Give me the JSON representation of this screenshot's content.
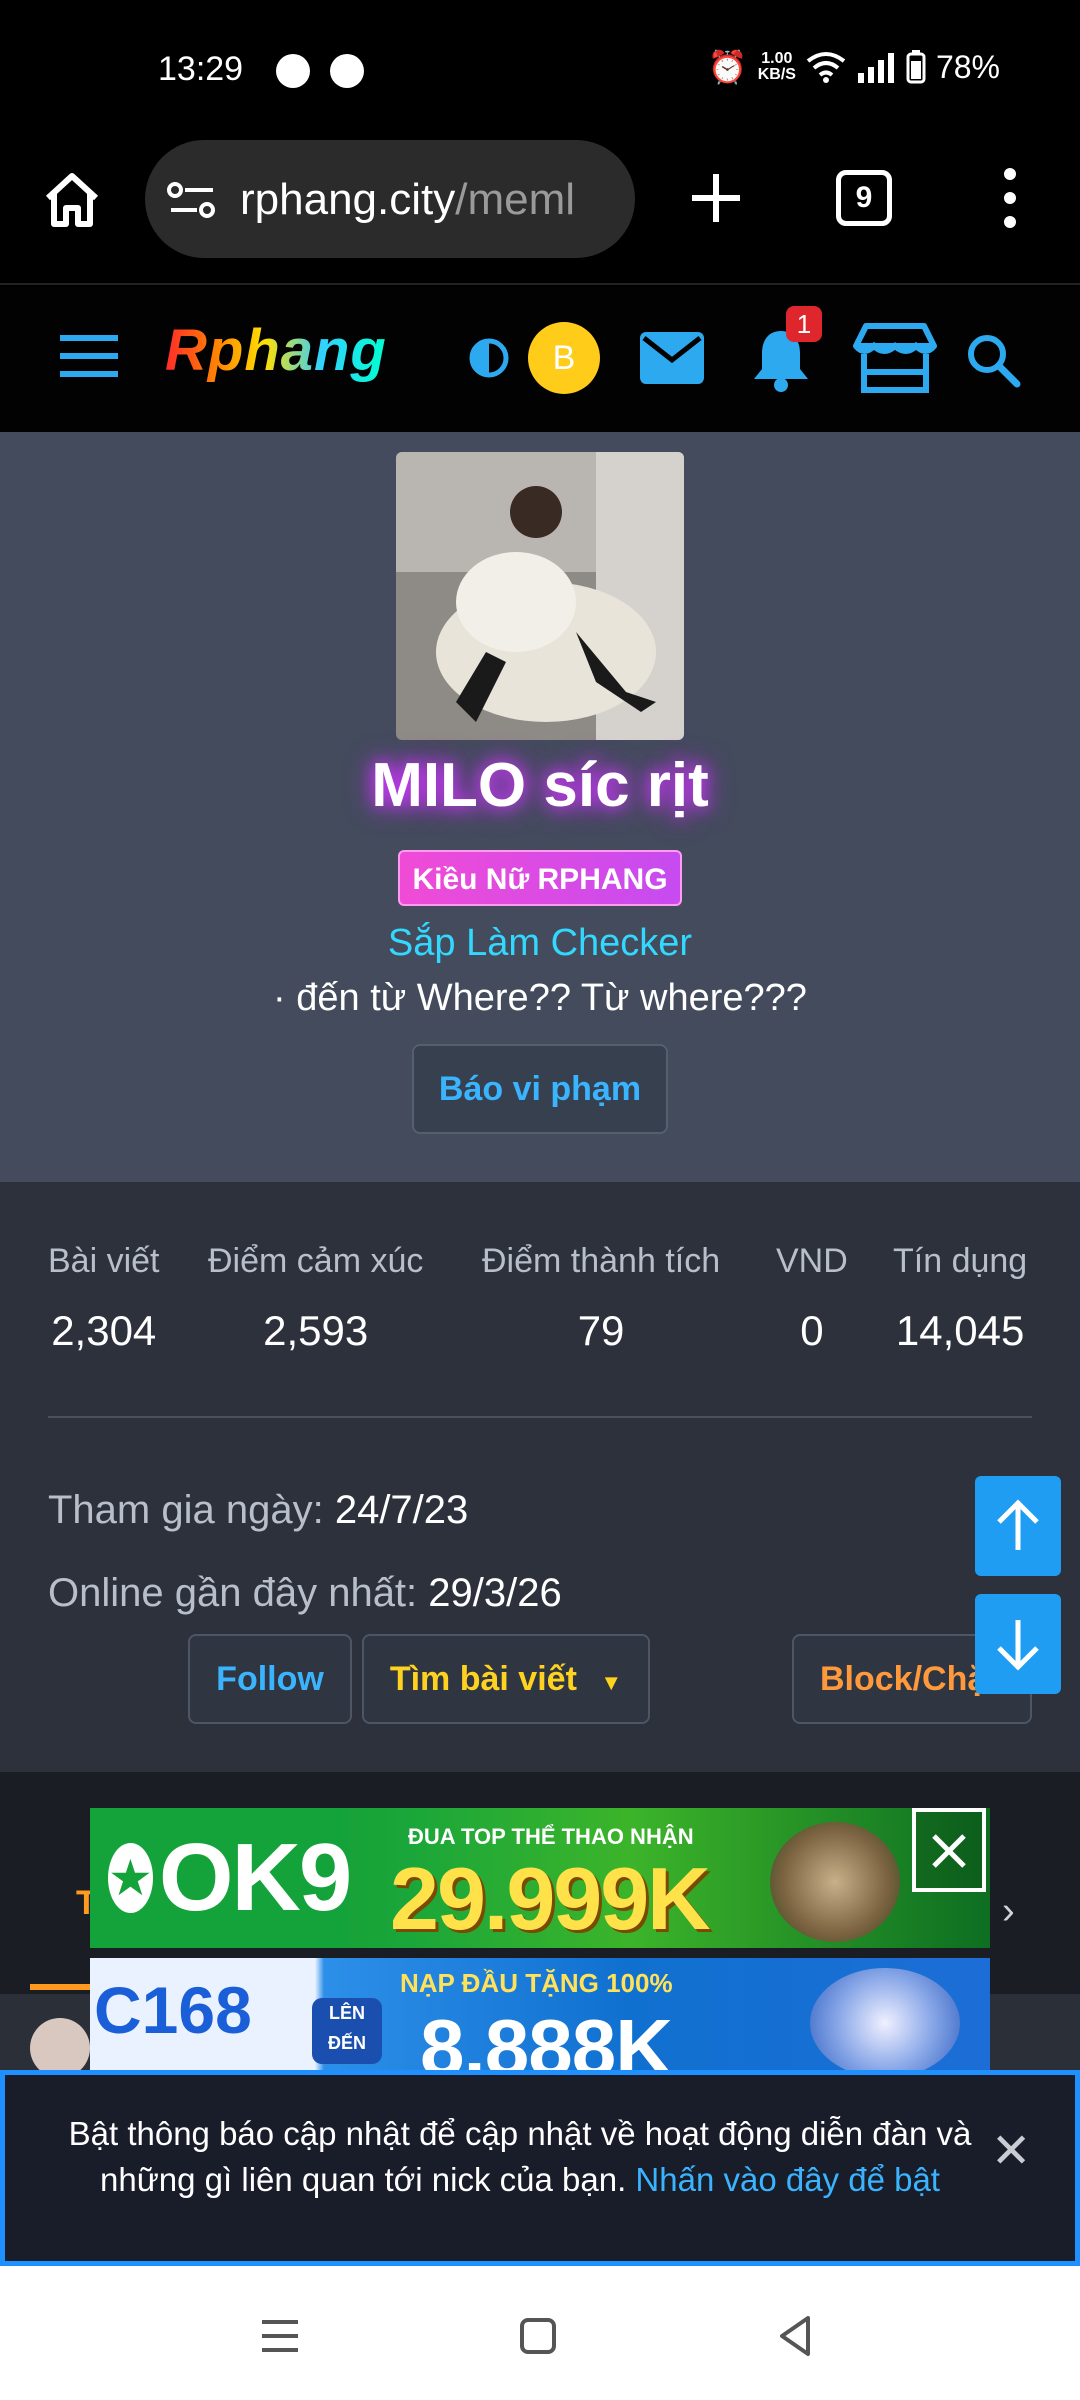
{
  "status_bar": {
    "time": "13:29",
    "speed_value": "1.00",
    "speed_unit": "KB/S",
    "battery": "78%"
  },
  "browser": {
    "url_host": "rphang.city",
    "url_path": "/meml",
    "tab_count": "9"
  },
  "site": {
    "logo": "Rphang",
    "user_initial": "B",
    "notification_count": "1"
  },
  "profile": {
    "username": "MILO síc rịt",
    "rank_badge": "Kiều Nữ RPHANG",
    "role": "Sắp Làm Checker",
    "location": "· đến từ Where?? Từ where???",
    "report_button": "Báo vi phạm"
  },
  "stats": [
    {
      "label": "Bài viết",
      "value": "2,304"
    },
    {
      "label": "Điểm cảm xúc",
      "value": "2,593"
    },
    {
      "label": "Điểm thành tích",
      "value": "79"
    },
    {
      "label": "VND",
      "value": "0"
    },
    {
      "label": "Tín dụng",
      "value": "14,045"
    }
  ],
  "info": {
    "joined_label": "Tham gia ngày:",
    "joined_value": "24/7/23",
    "last_online_label": "Online gần đây nhất:",
    "last_online_value": "29/3/26"
  },
  "actions": {
    "follow": "Follow",
    "find_posts": "Tìm bài viết",
    "block": "Block/Chặn"
  },
  "tabs": {
    "first_tab_initial": "T",
    "chevron": "›"
  },
  "ads": {
    "ad1_logo": "OK9",
    "ad1_sub": "ĐUA TOP THỂ THAO NHẬN",
    "ad1_amount": "29.999K",
    "ad2_logo": "C168",
    "ad2_chip": "LÊN ĐẾN",
    "ad2_sub": "NẠP ĐẦU TẶNG 100%",
    "ad2_amount": "8.888K"
  },
  "notification": {
    "text": "Bật thông báo cập nhật để cập nhật về hoạt động diễn đàn và những gì liên quan tới nick của bạn.",
    "link": "Nhấn vào đây để bật",
    "close": "✕"
  },
  "colors": {
    "accent_blue": "#3ab4ff",
    "highlight_yellow": "#ffd21f",
    "warning_orange": "#ff9a3c",
    "profile_bg": "#434b5d",
    "stats_bg": "#2c313c"
  }
}
